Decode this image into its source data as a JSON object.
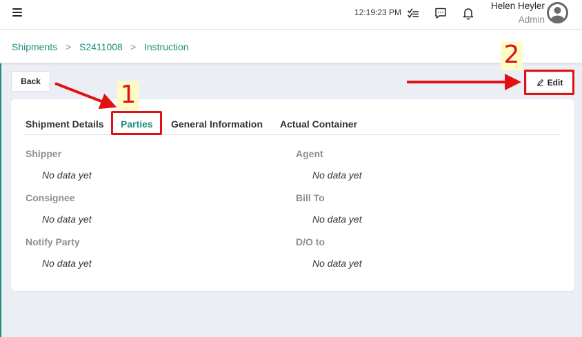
{
  "topbar": {
    "time": "12:19:23 PM",
    "user_name": "Helen Heyler",
    "user_role": "Admin"
  },
  "breadcrumb": {
    "items": [
      "Shipments",
      "S2411008",
      "Instruction"
    ],
    "separator": ">"
  },
  "actions": {
    "back_label": "Back",
    "edit_label": "Edit"
  },
  "tabs": {
    "items": [
      "Shipment Details",
      "Parties",
      "General Information",
      "Actual Container"
    ],
    "active": "Parties"
  },
  "parties": {
    "left": [
      {
        "label": "Shipper",
        "value": "No data yet"
      },
      {
        "label": "Consignee",
        "value": "No data yet"
      },
      {
        "label": "Notify Party",
        "value": "No data yet"
      }
    ],
    "right": [
      {
        "label": "Agent",
        "value": "No data yet"
      },
      {
        "label": "Bill To",
        "value": "No data yet"
      },
      {
        "label": "D/O to",
        "value": "No data yet"
      }
    ]
  },
  "annotations": {
    "step1": "1",
    "step2": "2"
  },
  "colors": {
    "accent": "#1a8f7d",
    "annotation": "#e21010",
    "annotation_bg": "#fdfbc6",
    "page_bg": "#eceef6"
  },
  "icons": [
    "menu-icon",
    "task-list-icon",
    "chat-icon",
    "bell-icon",
    "user-avatar-icon",
    "pencil-icon"
  ]
}
